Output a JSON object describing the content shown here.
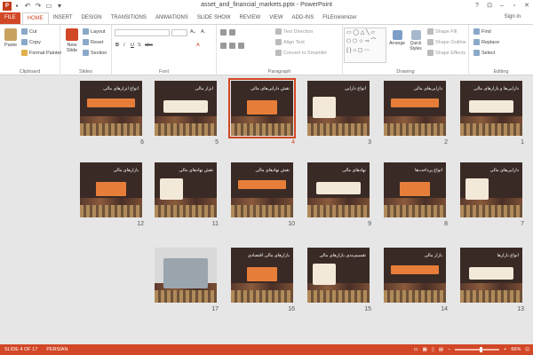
{
  "window": {
    "title": "asset_and_financial_markets.pptx - PowerPoint",
    "controls": [
      "?",
      "⊡",
      "–",
      "▫",
      "✕"
    ]
  },
  "tabs": [
    "FILE",
    "HOME",
    "INSERT",
    "DESIGN",
    "TRANSITIONS",
    "ANIMATIONS",
    "SLIDE SHOW",
    "REVIEW",
    "VIEW",
    "ADD-INS",
    "FILEminimizer"
  ],
  "active_tab": "HOME",
  "signin": "Sign in",
  "ribbon": {
    "clipboard": {
      "paste": "Paste",
      "cut": "Cut",
      "copy": "Copy",
      "format_painter": "Format Painter",
      "label": "Clipboard"
    },
    "slides": {
      "new_slide": "New Slide",
      "layout": "Layout",
      "reset": "Reset",
      "section": "Section",
      "label": "Slides"
    },
    "font": {
      "label": "Font"
    },
    "paragraph": {
      "text_direction": "Text Direction",
      "align_text": "Align Text",
      "convert_smartart": "Convert to SmartArt",
      "label": "Paragraph"
    },
    "drawing": {
      "arrange": "Arrange",
      "quick_styles": "Quick Styles",
      "shape_fill": "Shape Fill",
      "shape_outline": "Shape Outline",
      "shape_effects": "Shape Effects",
      "label": "Drawing"
    },
    "editing": {
      "find": "Find",
      "replace": "Replace",
      "select": "Select",
      "label": "Editing"
    }
  },
  "slides": [
    {
      "n": "1",
      "title": "دارایی‌ها و بازارهای مالی"
    },
    {
      "n": "2",
      "title": "دارایی‌های مالی"
    },
    {
      "n": "3",
      "title": "انواع دارایی"
    },
    {
      "n": "4",
      "title": "نقش دارایی‌های مالی"
    },
    {
      "n": "5",
      "title": "ابزار مالی"
    },
    {
      "n": "6",
      "title": "انواع ابزارهای مالی"
    },
    {
      "n": "7",
      "title": "دارایی‌های مالی"
    },
    {
      "n": "8",
      "title": "انواع پرداخت‌ها"
    },
    {
      "n": "9",
      "title": "نهادهای مالی"
    },
    {
      "n": "10",
      "title": "نقش نهادهای مالی"
    },
    {
      "n": "11",
      "title": "نقش نهادهای مالی"
    },
    {
      "n": "12",
      "title": "بازارهای مالی"
    },
    {
      "n": "13",
      "title": "انواع بازارها"
    },
    {
      "n": "14",
      "title": "بازار مالی"
    },
    {
      "n": "15",
      "title": "تقسیم‌بندی بازارهای مالی"
    },
    {
      "n": "16",
      "title": "بازارهای مالی اقتصادی"
    },
    {
      "n": "17",
      "title": ""
    }
  ],
  "selected_slide": "4",
  "status": {
    "slide_info": "SLIDE 4 OF 17",
    "language": "PERSIAN",
    "zoom": "66%",
    "zoom_fraction": 0.55
  }
}
